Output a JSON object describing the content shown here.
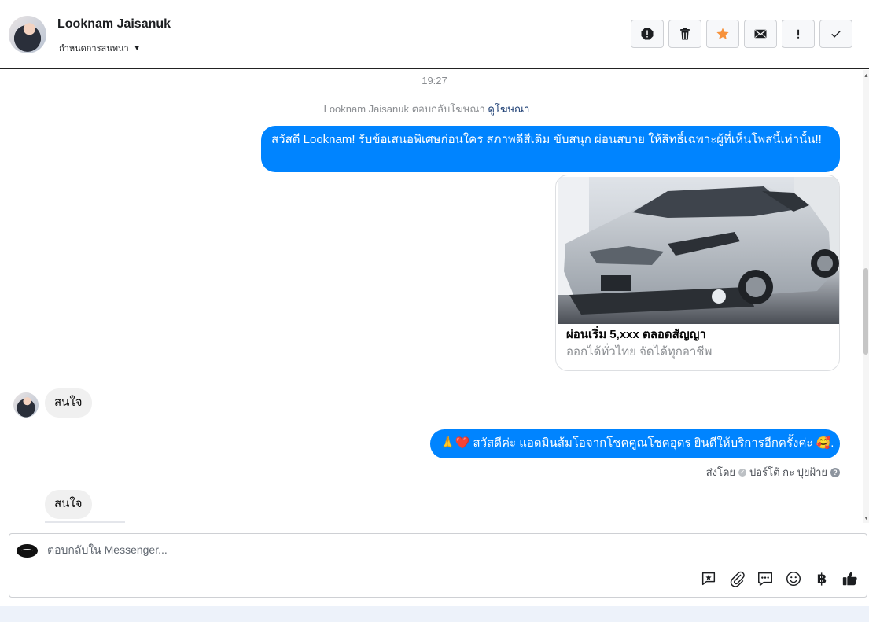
{
  "header": {
    "contact_name": "Looknam Jaisanuk",
    "assign_label": "กำหนดการสนทนา",
    "assign_caret": "▼",
    "actions": [
      {
        "name": "spam-icon"
      },
      {
        "name": "trash-icon"
      },
      {
        "name": "star-icon"
      },
      {
        "name": "mail-icon"
      },
      {
        "name": "exclamation-icon"
      },
      {
        "name": "check-icon"
      }
    ]
  },
  "conversation": {
    "timestamp": "19:27",
    "reply_note": {
      "text": "Looknam Jaisanuk ตอบกลับโฆษณา",
      "link": "ดูโฆษณา"
    },
    "messages": [
      {
        "direction": "outgoing",
        "text": "สวัสดี Looknam! รับข้อเสนอพิเศษก่อนใคร สภาพดีสีเดิม ขับสนุก ผ่อนสบาย ให้สิทธิ์เฉพาะผู้ที่เห็นโพสนี้เท่านั้น!!"
      },
      {
        "direction": "outgoing",
        "type": "ad_card",
        "title": "ผ่อนเริ่ม 5,xxx ตลอดสัญญา",
        "subtitle": "ออกได้ทั่วไทย จัดได้ทุกอาชีพ"
      },
      {
        "direction": "incoming",
        "text": "สนใจ"
      },
      {
        "direction": "outgoing",
        "text": "🙏❤️ สวัสดีค่ะ แอดมินส้มโอจากโชคคูณโชคอุดร ยินดีให้บริการอีกครั้งค่ะ 🥰."
      },
      {
        "direction": "incoming",
        "text": "สนใจ"
      }
    ],
    "sent_by": {
      "prefix": "ส่งโดย",
      "agent": "ปอร์โต้ กะ ปุยฝ้าย",
      "help": "?"
    }
  },
  "composer": {
    "placeholder": "ตอบกลับใน Messenger...",
    "icons": [
      "saved-reply-icon",
      "attachment-icon",
      "chat-bubbles-icon",
      "emoji-icon",
      "baht-icon",
      "like-icon"
    ],
    "currency_symbol": "฿"
  },
  "colors": {
    "outgoing_bubble": "#0084ff",
    "incoming_bubble": "#f0f0f0",
    "star_accent": "#f7923b"
  }
}
